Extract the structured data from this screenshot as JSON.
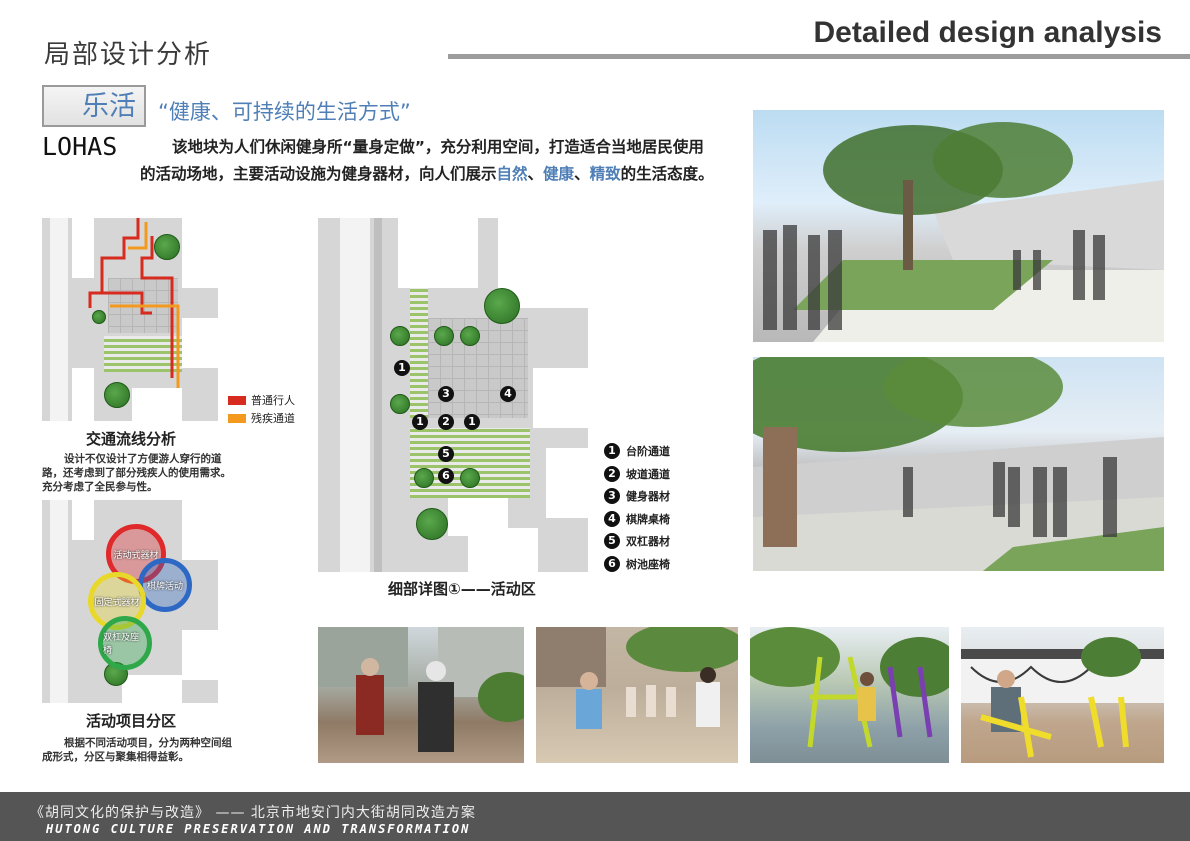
{
  "header": {
    "title_cn": "局部设计分析",
    "title_en": "Detailed design analysis"
  },
  "intro": {
    "tag": "乐活",
    "slogan": "“健康、可持续的生活方式”",
    "lohas": "LOHAS",
    "text_part1": "该地块为人们休闲健身所“量身定做”，充分利用空间，打造适合当地居民使用的活动场地，主要活动设施为健身器材，向人们展示",
    "hl1": "自然",
    "sep1": "、",
    "hl2": "健康",
    "sep2": "、",
    "hl3": "精致",
    "text_part2": "的生活态度。"
  },
  "traffic": {
    "legend": [
      {
        "label": "普通行人",
        "color": "#d62b1e"
      },
      {
        "label": "残疾通道",
        "color": "#f39a1e"
      }
    ],
    "caption": "交通流线分析",
    "desc": "设计不仅设计了方便游人穿行的道路，还考虑到了部分残疾人的使用需求。充分考虑了全民参与性。"
  },
  "zones": {
    "items": [
      {
        "label": "活动式器材",
        "color": "#e0292a"
      },
      {
        "label": "棋牌活动",
        "color": "#2d68c4"
      },
      {
        "label": "固定式器材",
        "color": "#e8d82a"
      },
      {
        "label": "双杠及座椅",
        "color": "#2fa84a"
      }
    ],
    "caption": "活动项目分区",
    "desc": "根据不同活动项目，分为两种空间组成形式，分区与聚集相得益彰。"
  },
  "detail": {
    "caption": "细部详图①——活动区",
    "legend": [
      {
        "num": "1",
        "label": "台阶通道"
      },
      {
        "num": "2",
        "label": "坡道通道"
      },
      {
        "num": "3",
        "label": "健身器材"
      },
      {
        "num": "4",
        "label": "棋牌桌椅"
      },
      {
        "num": "5",
        "label": "双杠器材"
      },
      {
        "num": "6",
        "label": "树池座椅"
      }
    ],
    "markers": [
      "1",
      "3",
      "4",
      "1",
      "2",
      "1",
      "5",
      "6"
    ]
  },
  "footer": {
    "cn": "《胡同文化的保护与改造》 ——  北京市地安门内大街胡同改造方案",
    "en": "HUTONG CULTURE PRESERVATION AND TRANSFORMATION"
  },
  "colors": {
    "accent_blue": "#4f7fb6",
    "footer_bg": "#555555",
    "grass": "#9bc36a"
  }
}
